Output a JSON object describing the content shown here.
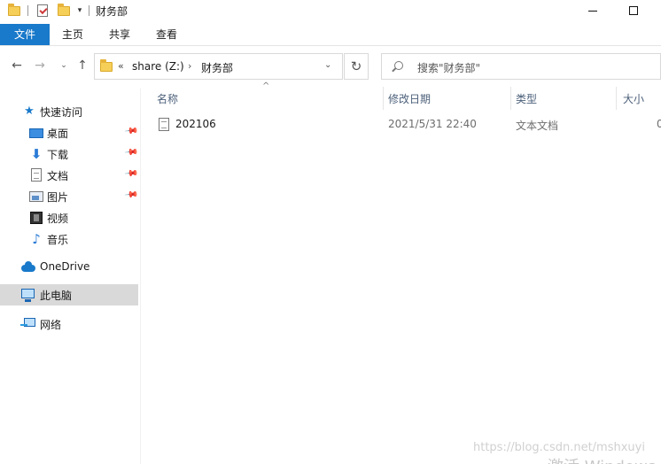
{
  "window": {
    "title": "财务部",
    "controls": {
      "minimize": "minimize-icon",
      "maximize": "maximize-icon"
    }
  },
  "ribbon": {
    "tabs": [
      {
        "label": "文件",
        "active": true
      },
      {
        "label": "主页"
      },
      {
        "label": "共享"
      },
      {
        "label": "查看"
      }
    ],
    "accent_color": "#1979ca"
  },
  "address_bar": {
    "overflow": "«",
    "segments": [
      "share (Z:)",
      "财务部"
    ],
    "separator": "›"
  },
  "search": {
    "placeholder": "搜索\"财务部\""
  },
  "nav_pane": {
    "quick_access": "快速访问",
    "pinned": [
      {
        "label": "桌面",
        "icon": "desktop-icon",
        "pinned": true
      },
      {
        "label": "下载",
        "icon": "download-icon",
        "pinned": true
      },
      {
        "label": "文档",
        "icon": "documents-icon",
        "pinned": true
      },
      {
        "label": "图片",
        "icon": "pictures-icon",
        "pinned": true
      },
      {
        "label": "视频",
        "icon": "videos-icon"
      },
      {
        "label": "音乐",
        "icon": "music-icon"
      }
    ],
    "onedrive": "OneDrive",
    "this_pc": "此电脑",
    "network": "网络"
  },
  "columns": {
    "name": "名称",
    "modified": "修改日期",
    "type": "类型",
    "size": "大小"
  },
  "files": [
    {
      "name": "202106",
      "modified": "2021/5/31 22:40",
      "type": "文本文档",
      "size": "0"
    }
  ],
  "overlay": {
    "watermark": "https://blog.csdn.net/mshxuyi",
    "activate": "激活 Windows"
  }
}
